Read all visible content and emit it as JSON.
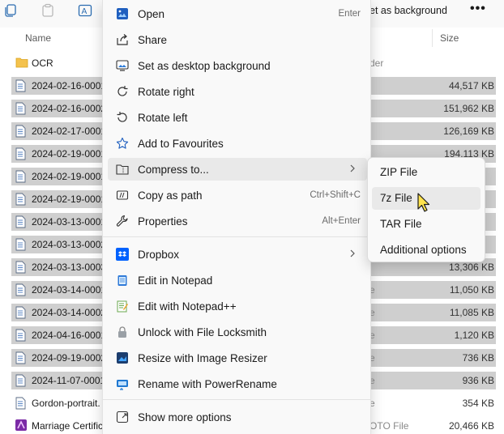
{
  "toolbar": {
    "partial_text": "et as background",
    "more": "•••",
    "icons": [
      "copy-icon",
      "paste-icon",
      "rename-icon"
    ]
  },
  "columns": {
    "name": "Name",
    "size": "Size"
  },
  "files": [
    {
      "name": "OCR",
      "type": "der",
      "size": "",
      "kind": "folder",
      "selected": false
    },
    {
      "name": "2024-02-16-0001",
      "type": "",
      "size": "44,517 KB",
      "kind": "doc",
      "selected": true
    },
    {
      "name": "2024-02-16-0002",
      "type": "",
      "size": "151,962 KB",
      "kind": "doc",
      "selected": true
    },
    {
      "name": "2024-02-17-0001",
      "type": "",
      "size": "126,169 KB",
      "kind": "doc",
      "selected": true
    },
    {
      "name": "2024-02-19-0001",
      "type": "",
      "size": "194,113 KB",
      "kind": "doc",
      "selected": true
    },
    {
      "name": "2024-02-19-0001",
      "type": "",
      "size": "",
      "kind": "doc",
      "selected": true
    },
    {
      "name": "2024-02-19-0001",
      "type": "",
      "size": "",
      "kind": "doc",
      "selected": true
    },
    {
      "name": "2024-03-13-0001",
      "type": "",
      "size": "",
      "kind": "doc",
      "selected": true
    },
    {
      "name": "2024-03-13-0002",
      "type": "",
      "size": "",
      "kind": "doc",
      "selected": true
    },
    {
      "name": "2024-03-13-0003",
      "type": "",
      "size": "13,306 KB",
      "kind": "doc",
      "selected": true
    },
    {
      "name": "2024-03-14-0001",
      "type": "e",
      "size": "11,050 KB",
      "kind": "doc",
      "selected": true
    },
    {
      "name": "2024-03-14-0002",
      "type": "e",
      "size": "11,085 KB",
      "kind": "doc",
      "selected": true
    },
    {
      "name": "2024-04-16-0001",
      "type": "e",
      "size": "1,120 KB",
      "kind": "doc",
      "selected": true
    },
    {
      "name": "2024-09-19-0002",
      "type": "e",
      "size": "736 KB",
      "kind": "doc",
      "selected": true
    },
    {
      "name": "2024-11-07-0001",
      "type": "e",
      "size": "936 KB",
      "kind": "doc",
      "selected": true
    },
    {
      "name": "Gordon-portrait.",
      "type": "e",
      "size": "354 KB",
      "kind": "doc",
      "selected": false
    },
    {
      "name": "Marriage Certific",
      "type": "OTO File",
      "size": "20,466 KB",
      "kind": "affinity",
      "selected": false
    }
  ],
  "menu": {
    "items": [
      {
        "label": "Open",
        "shortcut": "Enter",
        "icon": "open-icon"
      },
      {
        "label": "Share",
        "shortcut": "",
        "icon": "share-icon"
      },
      {
        "label": "Set as desktop background",
        "shortcut": "",
        "icon": "desktop-background-icon"
      },
      {
        "label": "Rotate right",
        "shortcut": "",
        "icon": "rotate-right-icon"
      },
      {
        "label": "Rotate left",
        "shortcut": "",
        "icon": "rotate-left-icon"
      },
      {
        "label": "Add to Favourites",
        "shortcut": "",
        "icon": "star-icon"
      },
      {
        "label": "Compress to...",
        "shortcut": "",
        "icon": "zip-folder-icon",
        "submenu": true
      },
      {
        "label": "Copy as path",
        "shortcut": "Ctrl+Shift+C",
        "icon": "copy-path-icon"
      },
      {
        "label": "Properties",
        "shortcut": "Alt+Enter",
        "icon": "wrench-icon"
      },
      {
        "label": "Dropbox",
        "shortcut": "",
        "icon": "dropbox-icon",
        "submenu": true
      },
      {
        "label": "Edit in Notepad",
        "shortcut": "",
        "icon": "notepad-icon"
      },
      {
        "label": "Edit with Notepad++",
        "shortcut": "",
        "icon": "notepad-plus-plus-icon"
      },
      {
        "label": "Unlock with File Locksmith",
        "shortcut": "",
        "icon": "lock-icon"
      },
      {
        "label": "Resize with Image Resizer",
        "shortcut": "",
        "icon": "image-resizer-icon"
      },
      {
        "label": "Rename with PowerRename",
        "shortcut": "",
        "icon": "power-rename-icon"
      },
      {
        "label": "Show more options",
        "shortcut": "",
        "icon": "show-more-icon"
      }
    ]
  },
  "submenu": {
    "items": [
      {
        "label": "ZIP File"
      },
      {
        "label": "7z File"
      },
      {
        "label": "TAR File"
      },
      {
        "label": "Additional options"
      }
    ]
  },
  "colors": {
    "accent": "#0067c0",
    "selection": "#cfcfcf",
    "hover": "#e9e9e9",
    "cursor": "#ffe34d"
  }
}
